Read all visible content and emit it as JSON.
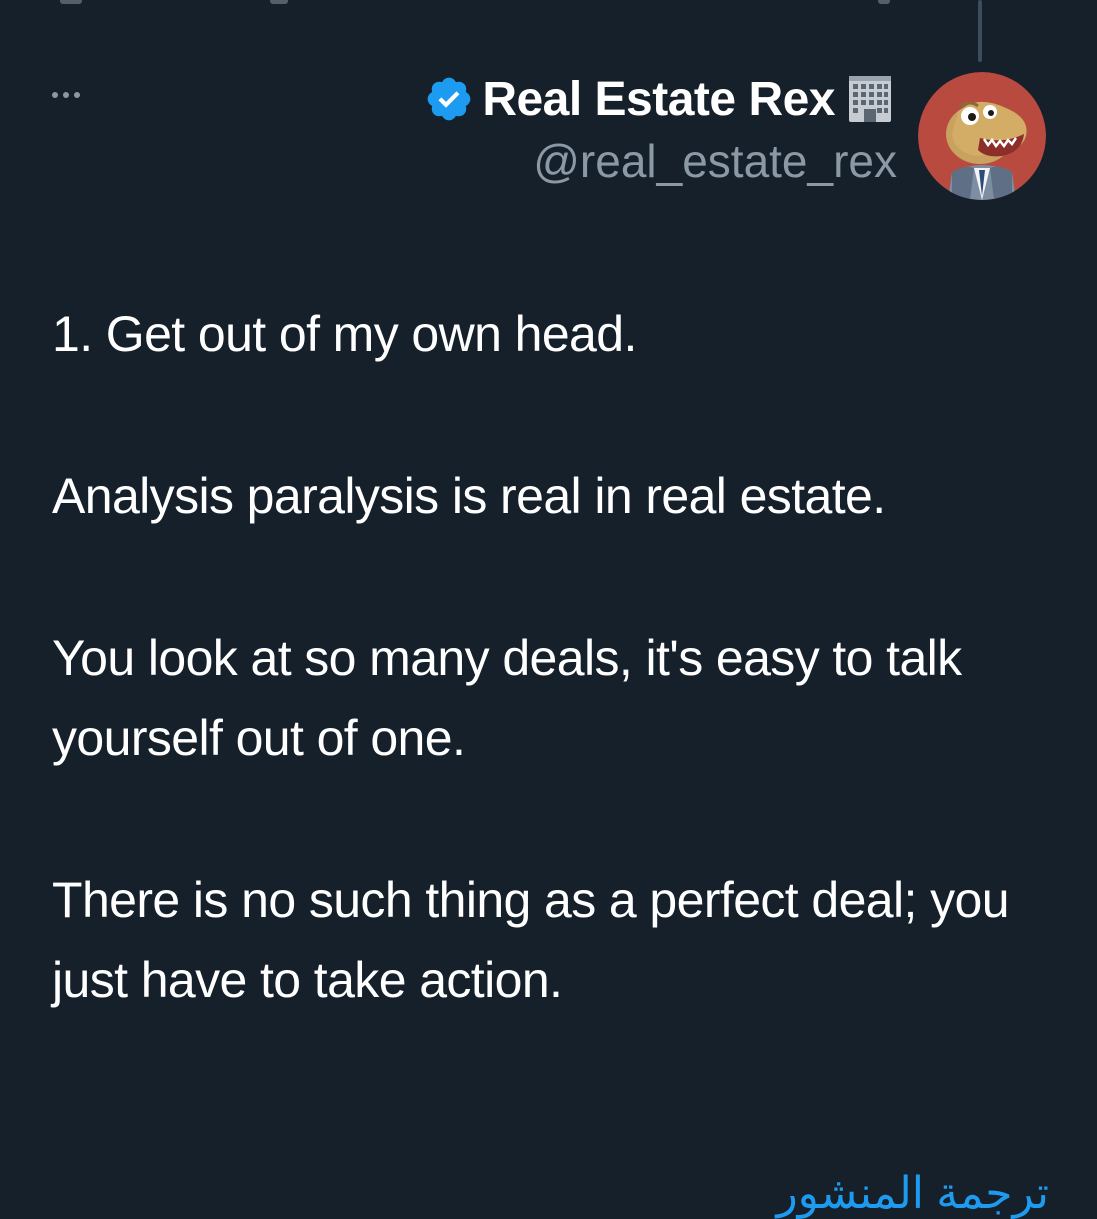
{
  "tweet": {
    "author": {
      "display_name": "Real Estate Rex",
      "name_emoji": "office-building-emoji",
      "handle": "@real_estate_rex",
      "verified": true,
      "verified_badge_color": "#1d9bf0",
      "avatar": "dinosaur-in-suit-avatar",
      "avatar_background": "#b84a3f"
    },
    "body": {
      "paragraphs": [
        "1. Get out of my own head.",
        "Analysis paralysis is real in real estate.",
        "You look at so many deals, it's easy to talk yourself out of one.",
        "There is no such thing as a perfect deal; you just have to take action."
      ]
    },
    "translate_link": "ترجمة المنشور",
    "more_icon": "more-dots-icon"
  },
  "theme": {
    "background": "#15202b",
    "text": "#ffffff",
    "secondary_text": "#8b98a5",
    "accent": "#1d9bf0"
  }
}
